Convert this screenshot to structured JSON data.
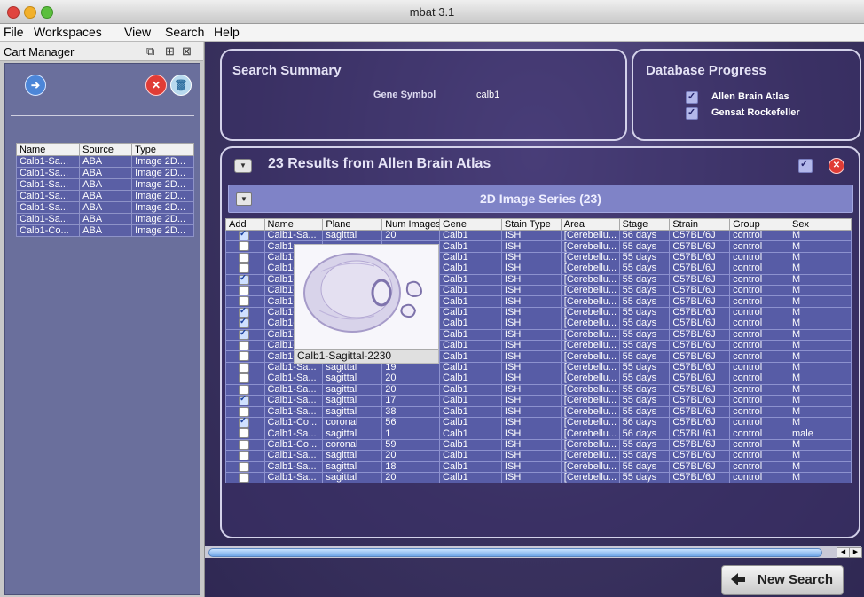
{
  "window": {
    "title": "mbat 3.1"
  },
  "menu": [
    "File",
    "Workspaces",
    "View",
    "Search",
    "Help"
  ],
  "cart": {
    "title": "Cart Manager",
    "columns": [
      "Name",
      "Source",
      "Type"
    ],
    "rows": [
      [
        "Calb1-Sa...",
        "ABA",
        "Image 2D..."
      ],
      [
        "Calb1-Sa...",
        "ABA",
        "Image 2D..."
      ],
      [
        "Calb1-Sa...",
        "ABA",
        "Image 2D..."
      ],
      [
        "Calb1-Sa...",
        "ABA",
        "Image 2D..."
      ],
      [
        "Calb1-Sa...",
        "ABA",
        "Image 2D..."
      ],
      [
        "Calb1-Sa...",
        "ABA",
        "Image 2D..."
      ],
      [
        "Calb1-Co...",
        "ABA",
        "Image 2D..."
      ]
    ]
  },
  "search_summary": {
    "title": "Search Summary",
    "label": "Gene Symbol",
    "value": "calb1"
  },
  "database_progress": {
    "title": "Database Progress",
    "items": [
      "Allen Brain Atlas",
      "Gensat Rockefeller"
    ]
  },
  "results": {
    "title": "23 Results from Allen Brain Atlas",
    "series_title": "2D Image Series (23)",
    "columns": [
      "Add",
      "Name",
      "Plane",
      "Num Images",
      "Gene",
      "Stain Type",
      "Area",
      "Stage",
      "Strain",
      "Group",
      "Sex"
    ],
    "rows": [
      [
        true,
        "Calb1-Sa...",
        "sagittal",
        "20",
        "Calb1",
        "ISH",
        "[Cerebellu...",
        "56 days",
        "C57BL/6J",
        "control",
        "M"
      ],
      [
        false,
        "Calb1-",
        "",
        "",
        "Calb1",
        "ISH",
        "[Cerebellu...",
        "55 days",
        "C57BL/6J",
        "control",
        "M"
      ],
      [
        false,
        "Calb1-",
        "",
        "",
        "Calb1",
        "ISH",
        "[Cerebellu...",
        "55 days",
        "C57BL/6J",
        "control",
        "M"
      ],
      [
        false,
        "Calb1-",
        "",
        "",
        "Calb1",
        "ISH",
        "[Cerebellu...",
        "55 days",
        "C57BL/6J",
        "control",
        "M"
      ],
      [
        true,
        "Calb1-",
        "",
        "",
        "Calb1",
        "ISH",
        "[Cerebellu...",
        "55 days",
        "C57BL/6J",
        "control",
        "M"
      ],
      [
        false,
        "Calb1-",
        "",
        "",
        "Calb1",
        "ISH",
        "[Cerebellu...",
        "55 days",
        "C57BL/6J",
        "control",
        "M"
      ],
      [
        false,
        "Calb1-",
        "",
        "",
        "Calb1",
        "ISH",
        "[Cerebellu...",
        "55 days",
        "C57BL/6J",
        "control",
        "M"
      ],
      [
        true,
        "Calb1-",
        "",
        "",
        "Calb1",
        "ISH",
        "[Cerebellu...",
        "55 days",
        "C57BL/6J",
        "control",
        "M"
      ],
      [
        true,
        "Calb1-",
        "",
        "",
        "Calb1",
        "ISH",
        "[Cerebellu...",
        "55 days",
        "C57BL/6J",
        "control",
        "M"
      ],
      [
        true,
        "Calb1-",
        "",
        "",
        "Calb1",
        "ISH",
        "[Cerebellu...",
        "55 days",
        "C57BL/6J",
        "control",
        "M"
      ],
      [
        false,
        "Calb1-Sa...",
        "sagittal",
        "20",
        "Calb1",
        "ISH",
        "[Cerebellu...",
        "55 days",
        "C57BL/6J",
        "control",
        "M"
      ],
      [
        false,
        "Calb1-Sa...",
        "sagittal",
        "20",
        "Calb1",
        "ISH",
        "[Cerebellu...",
        "55 days",
        "C57BL/6J",
        "control",
        "M"
      ],
      [
        false,
        "Calb1-Sa...",
        "sagittal",
        "19",
        "Calb1",
        "ISH",
        "[Cerebellu...",
        "55 days",
        "C57BL/6J",
        "control",
        "M"
      ],
      [
        false,
        "Calb1-Sa...",
        "sagittal",
        "20",
        "Calb1",
        "ISH",
        "[Cerebellu...",
        "55 days",
        "C57BL/6J",
        "control",
        "M"
      ],
      [
        false,
        "Calb1-Sa...",
        "sagittal",
        "20",
        "Calb1",
        "ISH",
        "[Cerebellu...",
        "55 days",
        "C57BL/6J",
        "control",
        "M"
      ],
      [
        true,
        "Calb1-Sa...",
        "sagittal",
        "17",
        "Calb1",
        "ISH",
        "[Cerebellu...",
        "55 days",
        "C57BL/6J",
        "control",
        "M"
      ],
      [
        false,
        "Calb1-Sa...",
        "sagittal",
        "38",
        "Calb1",
        "ISH",
        "[Cerebellu...",
        "55 days",
        "C57BL/6J",
        "control",
        "M"
      ],
      [
        true,
        "Calb1-Co...",
        "coronal",
        "56",
        "Calb1",
        "ISH",
        "[Cerebellu...",
        "56 days",
        "C57BL/6J",
        "control",
        "M"
      ],
      [
        false,
        "Calb1-Sa...",
        "sagittal",
        "1",
        "Calb1",
        "ISH",
        "[Cerebellu...",
        "56 days",
        "C57BL/6J",
        "control",
        "male"
      ],
      [
        false,
        "Calb1-Co...",
        "coronal",
        "59",
        "Calb1",
        "ISH",
        "[Cerebellu...",
        "55 days",
        "C57BL/6J",
        "control",
        "M"
      ],
      [
        false,
        "Calb1-Sa...",
        "sagittal",
        "20",
        "Calb1",
        "ISH",
        "[Cerebellu...",
        "55 days",
        "C57BL/6J",
        "control",
        "M"
      ],
      [
        false,
        "Calb1-Sa...",
        "sagittal",
        "18",
        "Calb1",
        "ISH",
        "[Cerebellu...",
        "55 days",
        "C57BL/6J",
        "control",
        "M"
      ],
      [
        false,
        "Calb1-Sa...",
        "sagittal",
        "20",
        "Calb1",
        "ISH",
        "[Cerebellu...",
        "55 days",
        "C57BL/6J",
        "control",
        "M"
      ]
    ]
  },
  "preview": {
    "label": "Calb1-Sagittal-2230"
  },
  "new_search": {
    "label": "New Search"
  }
}
